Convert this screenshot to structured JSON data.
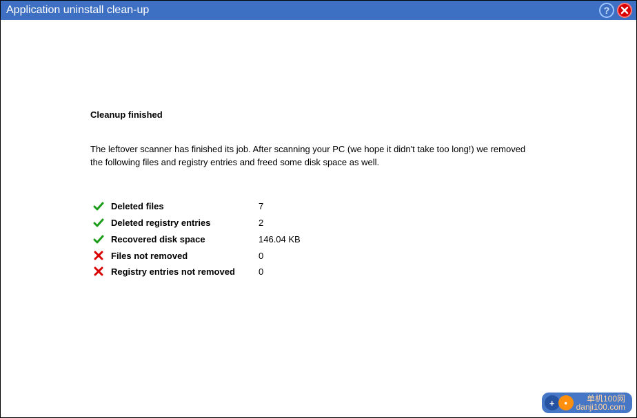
{
  "window": {
    "title": "Application uninstall clean-up"
  },
  "main": {
    "heading": "Cleanup finished",
    "description": "The leftover scanner has finished its job. After scanning your PC (we hope it didn't take too long!) we removed the following files and registry entries and freed some disk space as well."
  },
  "stats": [
    {
      "icon": "check",
      "label": "Deleted files",
      "value": "7"
    },
    {
      "icon": "check",
      "label": "Deleted registry entries",
      "value": "2"
    },
    {
      "icon": "check",
      "label": "Recovered disk space",
      "value": "146.04 KB"
    },
    {
      "icon": "cross",
      "label": "Files not removed",
      "value": "0"
    },
    {
      "icon": "cross",
      "label": "Registry entries not removed",
      "value": "0"
    }
  ],
  "watermark": {
    "line1": "单机100网",
    "line2": "danji100.com"
  }
}
